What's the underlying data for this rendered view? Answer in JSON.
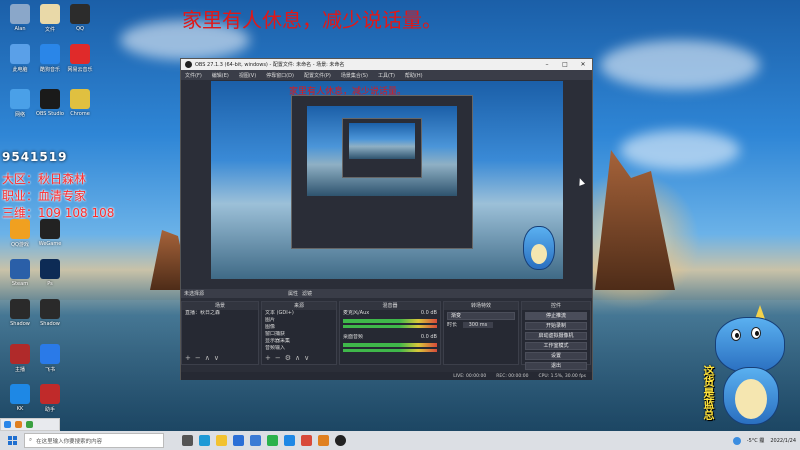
{
  "overlay": {
    "top_slogan": "家里有人休息，减少说话量。",
    "preview_slogan": "家里有人休息，减少说话量。"
  },
  "side_info": {
    "number": "9541519",
    "region": "大区：秋日森林",
    "job": "职业：血清专家",
    "sanwei": "三维：109 108 108"
  },
  "desktop_icons": [
    {
      "label": "Alan",
      "color": "#8aa7c9"
    },
    {
      "label": "文件",
      "color": "#e9d9a8"
    },
    {
      "label": "QQ",
      "color": "#2c2c2c"
    },
    {
      "label": "此电脑",
      "color": "#5aa0e8"
    },
    {
      "label": "酷狗音乐",
      "color": "#2a86e8"
    },
    {
      "label": "网易云音乐",
      "color": "#e02a2a"
    },
    {
      "label": "网络",
      "color": "#4aa0e8"
    },
    {
      "label": "OBS Studio",
      "color": "#1a1a1a"
    },
    {
      "label": "Chrome",
      "color": "#e0c040"
    },
    {
      "label": "QQ游戏",
      "color": "#f0a020"
    },
    {
      "label": "WeGame",
      "color": "#222222"
    },
    {
      "label": "Steam",
      "color": "#2a5fa8"
    },
    {
      "label": "Ps",
      "color": "#0d2b55"
    },
    {
      "label": "Shadow",
      "color": "#2a2a2a"
    },
    {
      "label": "Shadow",
      "color": "#2a2a2a"
    },
    {
      "label": "主播",
      "color": "#b02a2a"
    },
    {
      "label": "飞书",
      "color": "#2a7ae8"
    },
    {
      "label": "KK",
      "color": "#1e88e5"
    },
    {
      "label": "助手",
      "color": "#c02a2a"
    }
  ],
  "obs": {
    "title": "OBS 27.1.3 (64-bit, windows) - 配置文件: 未命名 - 场景: 未命名",
    "menu": [
      "文件(F)",
      "编辑(E)",
      "视图(V)",
      "停靠窗口(D)",
      "配置文件(P)",
      "场景集合(S)",
      "工具(T)",
      "帮助(H)"
    ],
    "dock_bar": "未选择源",
    "dock_bar_btn1": "属性",
    "dock_bar_btn2": "滤镜",
    "scenes_header": "场景",
    "scene_item": "直播：秋日之森",
    "sources_header": "来源",
    "sources": [
      "文本 (GDI+)",
      "图片",
      "图像",
      "窗口捕获",
      "显示器采集",
      "音频输入"
    ],
    "mixer_header": "混音器",
    "mixer": [
      {
        "name": "麦克风/Aux",
        "db": "0.0 dB"
      },
      {
        "name": "桌面音频",
        "db": "0.0 dB"
      }
    ],
    "transitions_header": "转场特效",
    "transition": "渐变",
    "duration_label": "时长",
    "duration": "300 ms",
    "controls_header": "控件",
    "controls": [
      "停止推流",
      "开始录制",
      "启动虚拟摄像机",
      "工作室模式",
      "设置",
      "退出"
    ],
    "status": {
      "live": "LIVE: 00:00:00",
      "rec": "REC: 00:00:00",
      "cpu": "CPU: 1.5%, 30.00 fps"
    }
  },
  "mascot_text": "这货是蓝总",
  "taskbar": {
    "search_placeholder": "在这里输入你要搜索的内容",
    "weather": "-5°C 霾",
    "time": "2022/1/24"
  }
}
